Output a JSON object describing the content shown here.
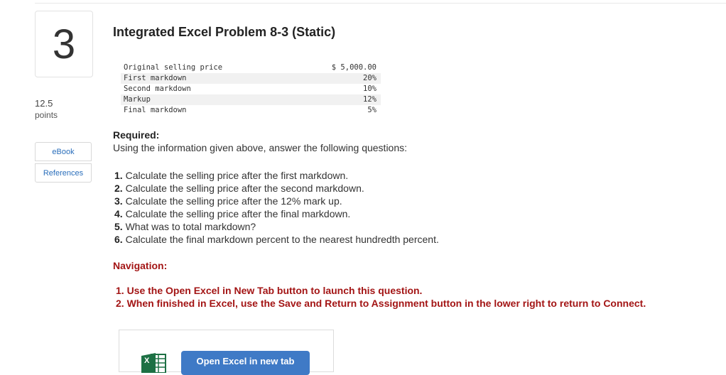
{
  "question": {
    "number": "3",
    "points_value": "12.5",
    "points_label": "points"
  },
  "sidebar": {
    "ebook_label": "eBook",
    "references_label": "References"
  },
  "problem": {
    "title": "Integrated Excel Problem 8-3 (Static)",
    "data_rows": [
      {
        "label": "Original selling price",
        "value": "$ 5,000.00"
      },
      {
        "label": "First markdown",
        "value": "20%"
      },
      {
        "label": "Second markdown",
        "value": "10%"
      },
      {
        "label": "Markup",
        "value": "12%"
      },
      {
        "label": "Final markdown",
        "value": "5%"
      }
    ],
    "required_heading": "Required:",
    "required_text": "Using the information given above, answer the following questions:",
    "questions": [
      {
        "num": "1.",
        "text": " Calculate the selling price after the first markdown."
      },
      {
        "num": "2.",
        "text": " Calculate the selling price after the second markdown."
      },
      {
        "num": "3.",
        "text": " Calculate the selling price after the 12% mark up."
      },
      {
        "num": "4.",
        "text": " Calculate the selling price after the final markdown."
      },
      {
        "num": "5.",
        "text": " What was to total markdown?"
      },
      {
        "num": "6.",
        "text": " Calculate the final markdown percent to the nearest hundredth percent."
      }
    ],
    "navigation_heading": "Navigation:",
    "navigation_items": [
      "1. Use the Open Excel in New Tab button to launch this question.",
      "2. When finished in Excel, use the Save and Return to Assignment button in the lower right to return to Connect."
    ]
  },
  "excel_panel": {
    "button_label": "Open Excel in new tab",
    "icon": "excel-icon",
    "brand_color": "#1d7044",
    "button_color": "#3f7ac6"
  }
}
